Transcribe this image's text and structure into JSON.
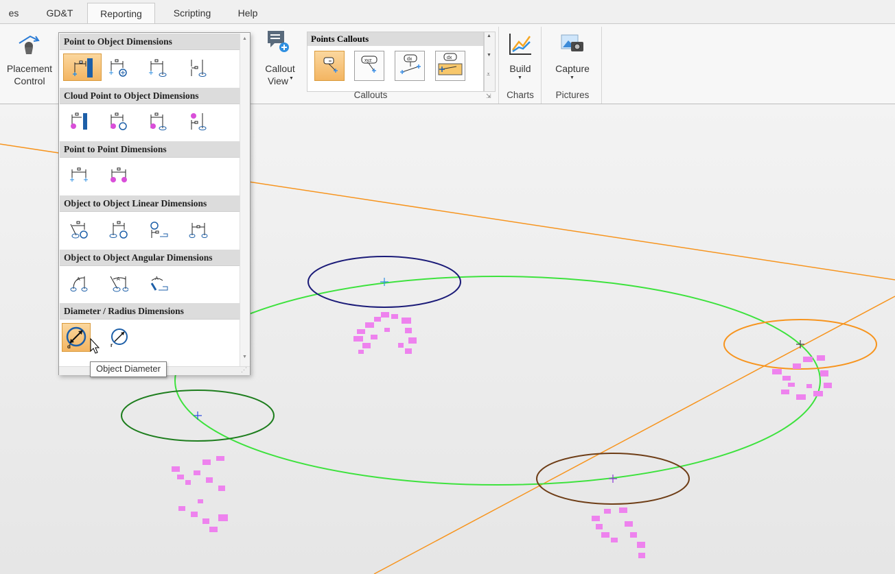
{
  "tabs": [
    {
      "label": "es"
    },
    {
      "label": "GD&T"
    },
    {
      "label": "Reporting"
    },
    {
      "label": "Scripting"
    },
    {
      "label": "Help"
    }
  ],
  "ribbon": {
    "placement_line1": "Placement",
    "placement_line2": "Control",
    "callout_line1": "Callout",
    "callout_line2": "View",
    "points_callouts_title": "Points Callouts",
    "callouts_group": "Callouts",
    "build_label": "Build",
    "charts_group": "Charts",
    "capture_label": "Capture",
    "pictures_group": "Pictures",
    "callout_icons": [
      "callout-single-icon",
      "callout-xyz-icon",
      "callout-dx-icon",
      "callout-dx-multi-icon"
    ]
  },
  "dropdown": {
    "sections": [
      {
        "title": "Point to Object Dimensions",
        "icons": [
          "point-to-plane-icon",
          "point-to-circle-icon",
          "point-to-line-icon",
          "point-to-cylinder-icon"
        ]
      },
      {
        "title": "Cloud Point to Object Dimensions",
        "icons": [
          "cloud-to-plane-icon",
          "cloud-to-circle-icon",
          "cloud-to-line-icon",
          "cloud-to-cylinder-icon"
        ]
      },
      {
        "title": "Point to Point Dimensions",
        "icons": [
          "point-to-point-icon",
          "cloud-to-cloud-icon"
        ]
      },
      {
        "title": "Object to Object Linear Dimensions",
        "icons": [
          "line-to-circle-icon",
          "cylinder-to-circle-icon",
          "circle-to-plane-icon",
          "cylinder-to-cylinder-icon"
        ]
      },
      {
        "title": "Object to Object Angular Dimensions",
        "icons": [
          "angle-cylinder-icon",
          "angle-line-icon",
          "angle-plane-icon"
        ]
      },
      {
        "title": "Diameter / Radius Dimensions",
        "icons": [
          "diameter-icon",
          "radius-icon"
        ]
      }
    ],
    "selected_icon": "diameter-icon"
  },
  "tooltip": {
    "text": "Object Diameter"
  },
  "colors": {
    "accent": "#f3b562",
    "green_curve": "#3de23d",
    "orange_line": "#f7941d",
    "points": "#ee82ee"
  }
}
